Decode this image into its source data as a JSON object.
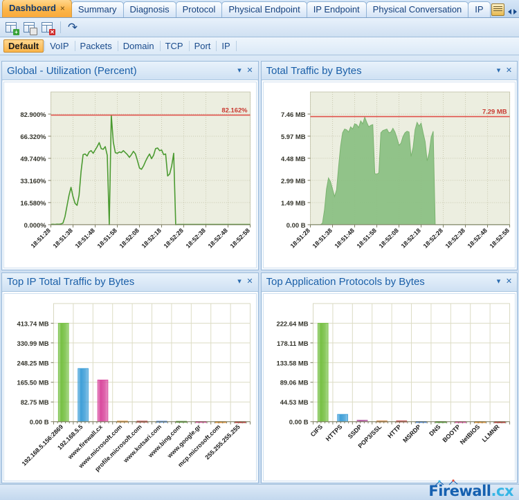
{
  "window": {
    "tabs": [
      {
        "label": "Dashboard",
        "active": true,
        "closable": true
      },
      {
        "label": "Summary",
        "active": false,
        "closable": false
      },
      {
        "label": "Diagnosis",
        "active": false,
        "closable": false
      },
      {
        "label": "Protocol",
        "active": false,
        "closable": false
      },
      {
        "label": "Physical Endpoint",
        "active": false,
        "closable": false
      },
      {
        "label": "IP Endpoint",
        "active": false,
        "closable": false
      },
      {
        "label": "Physical Conversation",
        "active": false,
        "closable": false
      },
      {
        "label": "IP",
        "active": false,
        "closable": false
      }
    ],
    "tab_close_glyph": "×",
    "tab_nav": {
      "prev": "◀",
      "next": "▶"
    }
  },
  "toolbar": {
    "buttons": [
      {
        "name": "new-panel",
        "icon": "panel-add-icon",
        "badge": "+"
      },
      {
        "name": "save-panel",
        "icon": "panel-save-icon",
        "badge": ""
      },
      {
        "name": "delete-panel",
        "icon": "panel-delete-icon",
        "badge": "×"
      },
      {
        "name": "refresh",
        "icon": "refresh-icon",
        "badge": ""
      }
    ],
    "refresh_glyph": "↷"
  },
  "viewbar": {
    "items": [
      "Default",
      "VoIP",
      "Packets",
      "Domain",
      "TCP",
      "Port",
      "IP"
    ],
    "active": "Default"
  },
  "panels": [
    {
      "title": "Global - Utilization (Percent)",
      "menu_glyph": "▾",
      "close_glyph": "✕"
    },
    {
      "title": "Total Traffic by Bytes",
      "menu_glyph": "▾",
      "close_glyph": "✕"
    },
    {
      "title": "Top IP Total Traffic by Bytes",
      "menu_glyph": "▾",
      "close_glyph": "✕"
    },
    {
      "title": "Top Application Protocols by Bytes",
      "menu_glyph": "▾",
      "close_glyph": "✕"
    }
  ],
  "colors": {
    "line_green": "#4a9a30",
    "area_green": "#8cc084",
    "peak_red": "#e0504a",
    "bar_green": "#76c043",
    "bar_blue": "#3f9fd8",
    "bar_magenta": "#d94a9e",
    "bar_orange": "#e08a2a",
    "bar_darkred": "#b52a2a",
    "plot_bg": "#eceee0",
    "title_blue": "#1a5fa8",
    "accent_orange": "#f9b44a"
  },
  "footer": {
    "logo_main": "Firewall",
    "logo_suffix": ".cx"
  },
  "chart_data": [
    {
      "type": "line",
      "title": "Global - Utilization (Percent)",
      "xlabel": "",
      "ylabel": "",
      "grid": true,
      "ylim": [
        0,
        99.48
      ],
      "ytick_labels": [
        "0.000%",
        "16.580%",
        "33.160%",
        "49.740%",
        "66.320%",
        "82.900%"
      ],
      "ytick_values": [
        0,
        16.58,
        33.16,
        49.74,
        66.32,
        82.9
      ],
      "xtick_labels": [
        "18:51:28",
        "18:51:38",
        "18:51:48",
        "18:51:58",
        "18:52:08",
        "18:52:18",
        "18:52:28",
        "18:52:38",
        "18:52:48",
        "18:52:58"
      ],
      "peak_line": {
        "value": 82.162,
        "label": "82.162%"
      },
      "series": [
        {
          "name": "Utilization",
          "values": [
            0.2,
            0.3,
            0.2,
            0.4,
            0.3,
            0.5,
            1.2,
            6.0,
            14.0,
            22.0,
            28.0,
            21.0,
            16.0,
            14.5,
            22.0,
            40.0,
            52.5,
            53.0,
            51.5,
            54.5,
            55.5,
            53.5,
            56.0,
            58.5,
            61.5,
            57.0,
            56.5,
            58.5,
            52.0,
            0.0,
            82.1,
            62.0,
            54.0,
            53.5,
            54.5,
            54.0,
            55.5,
            54.0,
            52.5,
            50.5,
            52.5,
            55.0,
            53.0,
            48.0,
            42.5,
            41.5,
            44.0,
            47.5,
            50.5,
            53.0,
            49.5,
            52.0,
            57.0,
            57.5,
            55.5,
            56.0,
            52.5,
            53.0,
            36.5,
            38.0,
            44.0,
            53.5,
            0.0,
            0.2,
            0.2,
            0.2,
            0.2,
            0.2,
            0.2,
            0.2,
            0.2,
            0.2,
            0.2,
            0.2,
            0.2,
            0.2,
            0.2,
            0.2,
            0.2,
            0.2,
            0.2,
            0.2,
            0.2,
            0.2,
            0.2,
            0.2,
            0.2,
            0.2,
            0.2,
            0.2,
            0.2,
            0.2,
            0.2,
            0.2,
            0.2,
            0.2,
            0.2,
            0.2,
            0.2,
            0.2
          ]
        }
      ]
    },
    {
      "type": "area",
      "title": "Total Traffic by Bytes",
      "xlabel": "",
      "ylabel": "",
      "grid": true,
      "ylim": [
        0,
        8.95
      ],
      "ytick_labels": [
        "0.00 B",
        "1.49 MB",
        "2.99 MB",
        "4.48 MB",
        "5.97 MB",
        "7.46 MB"
      ],
      "ytick_values": [
        0,
        1.49,
        2.99,
        4.48,
        5.97,
        7.46
      ],
      "xtick_labels": [
        "18:51:28",
        "18:51:38",
        "18:51:48",
        "18:51:58",
        "18:52:08",
        "18:52:18",
        "18:52:28",
        "18:52:38",
        "18:52:48",
        "18:52:58"
      ],
      "peak_line": {
        "value": 7.29,
        "label": "7.29 MB"
      },
      "series": [
        {
          "name": "Total Traffic",
          "values": [
            0,
            0,
            0,
            0,
            0,
            0,
            0.1,
            1.0,
            2.4,
            3.15,
            2.9,
            2.4,
            1.9,
            2.35,
            3.9,
            5.3,
            6.2,
            6.45,
            6.4,
            6.25,
            6.6,
            6.45,
            6.8,
            6.75,
            6.55,
            7.0,
            6.8,
            7.25,
            6.9,
            6.6,
            6.7,
            6.75,
            3.45,
            3.4,
            3.5,
            6.2,
            6.35,
            6.4,
            6.45,
            6.2,
            6.25,
            6.5,
            6.25,
            5.85,
            5.35,
            5.5,
            5.95,
            6.2,
            6.3,
            6.25,
            4.6,
            5.2,
            6.4,
            6.9,
            6.65,
            6.85,
            6.2,
            5.6,
            4.3,
            4.85,
            5.9,
            6.3,
            0,
            0,
            0,
            0,
            0,
            0,
            0,
            0,
            0,
            0,
            0,
            0,
            0,
            0,
            0,
            0,
            0,
            0,
            0,
            0,
            0,
            0,
            0,
            0,
            0,
            0,
            0,
            0,
            0,
            0,
            0,
            0,
            0,
            0,
            0,
            0,
            0,
            0
          ]
        }
      ]
    },
    {
      "type": "bar",
      "title": "Top IP Total Traffic by Bytes",
      "xlabel": "",
      "ylabel": "",
      "grid": true,
      "ylim": [
        0,
        496.49
      ],
      "ytick_labels": [
        "0.00 B",
        "82.75 MB",
        "165.50 MB",
        "248.25 MB",
        "330.99 MB",
        "413.74 MB"
      ],
      "ytick_values": [
        0,
        82.75,
        165.5,
        248.25,
        330.99,
        413.74
      ],
      "categories": [
        "192.168.5.156:2869",
        "192.168.5.5",
        "www.firewall.cx",
        "www.microsoft.com",
        "profile.microsoft.com",
        "www.kotsari.com",
        "www.bing.com",
        "www.google.gr",
        "mcp.microsoft.com",
        "255.255.255.255"
      ],
      "values": [
        413.74,
        223.4,
        175.2,
        2.4,
        2.2,
        2.0,
        1.6,
        0.9,
        0.2,
        0.1
      ],
      "bar_colors": [
        "#76c043",
        "#3f9fd8",
        "#d94a9e",
        "#e08a2a",
        "#b52a2a",
        "#3f7fd8",
        "#4a9a30",
        "#d94a9e",
        "#e08a2a",
        "#b52a2a"
      ],
      "unit": "MB"
    },
    {
      "type": "bar",
      "title": "Top Application Protocols by Bytes",
      "xlabel": "",
      "ylabel": "",
      "grid": true,
      "ylim": [
        0,
        267.17
      ],
      "ytick_labels": [
        "0.00 B",
        "44.53 MB",
        "89.06 MB",
        "133.58 MB",
        "178.11 MB",
        "222.64 MB"
      ],
      "ytick_values": [
        0,
        44.53,
        89.06,
        133.58,
        178.11,
        222.64
      ],
      "categories": [
        "CIFS",
        "HTTPS",
        "SSDP",
        "POP3/SSL",
        "HTTP",
        "MSRDP",
        "DNS",
        "BOOTP",
        "NetBIOS",
        "LLMNR"
      ],
      "values": [
        222.64,
        16.5,
        3.2,
        1.6,
        1.6,
        0.4,
        0.3,
        0.2,
        0.1,
        0.05
      ],
      "bar_colors": [
        "#76c043",
        "#3f9fd8",
        "#b0539e",
        "#c8732a",
        "#b52a2a",
        "#3f7fd8",
        "#4a9a30",
        "#d94a9e",
        "#e08a2a",
        "#b52a2a"
      ],
      "unit": "MB"
    }
  ]
}
